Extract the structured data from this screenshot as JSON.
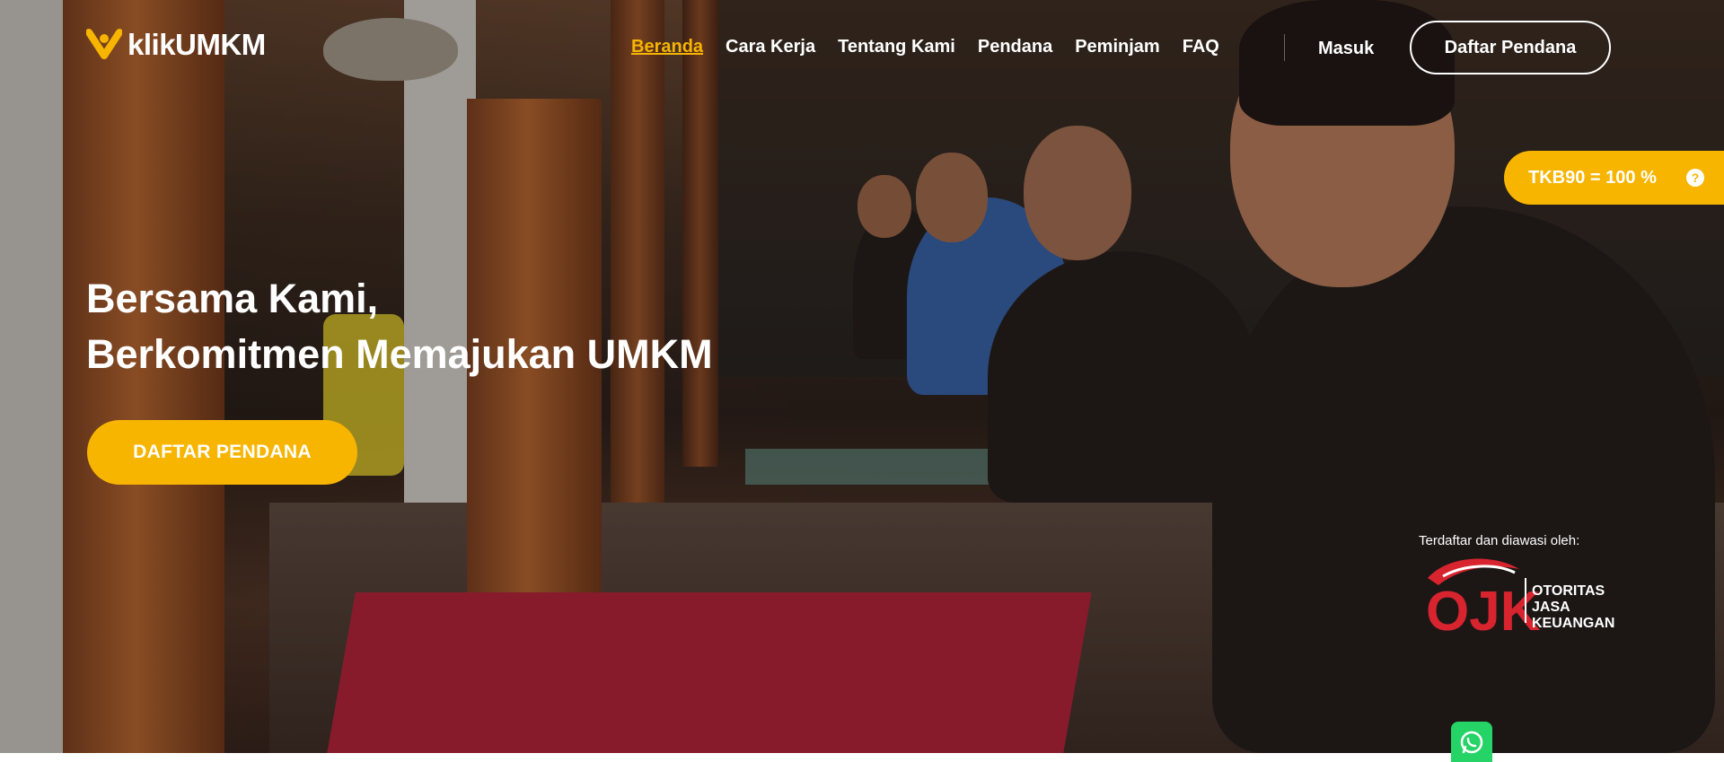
{
  "brand": {
    "name": "klikUMKM",
    "accent": "#f7b500"
  },
  "nav": {
    "items": [
      {
        "label": "Beranda",
        "active": true
      },
      {
        "label": "Cara Kerja"
      },
      {
        "label": "Tentang Kami"
      },
      {
        "label": "Pendana"
      },
      {
        "label": "Peminjam"
      },
      {
        "label": "FAQ"
      }
    ],
    "login_label": "Masuk",
    "register_label": "Daftar Pendana"
  },
  "tkb": {
    "label": "TKB90 = 100 %",
    "help_icon": "question-icon",
    "help_glyph": "?"
  },
  "hero": {
    "line1": "Bersama Kami,",
    "line2": "Berkomitmen Memajukan UMKM",
    "cta_label": "DAFTAR PENDANA"
  },
  "ojk": {
    "caption": "Terdaftar dan diawasi oleh:",
    "logo_letters": "OJK",
    "line1": "OTORITAS",
    "line2": "JASA",
    "line3": "KEUANGAN"
  },
  "whatsapp": {
    "icon": "whatsapp-icon"
  }
}
